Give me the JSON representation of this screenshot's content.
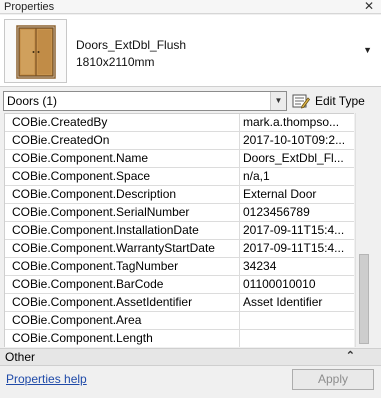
{
  "window": {
    "title": "Properties",
    "close_glyph": "✕"
  },
  "type": {
    "icon": "door-icon",
    "name": "Doors_ExtDbl_Flush",
    "size": "1810x2110mm",
    "chevron": "▼"
  },
  "selector": {
    "value": "Doors (1)",
    "arrow": "▼"
  },
  "edit_type": {
    "label": "Edit Type",
    "icon": "edit-type-icon"
  },
  "properties": [
    {
      "name": "COBie.CreatedBy",
      "value": "mark.a.thompso..."
    },
    {
      "name": "COBie.CreatedOn",
      "value": "2017-10-10T09:2..."
    },
    {
      "name": "COBie.Component.Name",
      "value": "Doors_ExtDbl_Fl..."
    },
    {
      "name": "COBie.Component.Space",
      "value": "n/a,1"
    },
    {
      "name": "COBie.Component.Description",
      "value": "External Door"
    },
    {
      "name": "COBie.Component.SerialNumber",
      "value": "0123456789"
    },
    {
      "name": "COBie.Component.InstallationDate",
      "value": "2017-09-11T15:4..."
    },
    {
      "name": "COBie.Component.WarrantyStartDate",
      "value": "2017-09-11T15:4..."
    },
    {
      "name": "COBie.Component.TagNumber",
      "value": "34234"
    },
    {
      "name": "COBie.Component.BarCode",
      "value": "01100010010"
    },
    {
      "name": "COBie.Component.AssetIdentifier",
      "value": "Asset Identifier"
    },
    {
      "name": "COBie.Component.Area",
      "value": ""
    },
    {
      "name": "COBie.Component.Length",
      "value": ""
    }
  ],
  "group": {
    "label": "Other",
    "collapse_glyph": "⌃"
  },
  "footer": {
    "help_label": "Properties help",
    "apply_label": "Apply"
  }
}
